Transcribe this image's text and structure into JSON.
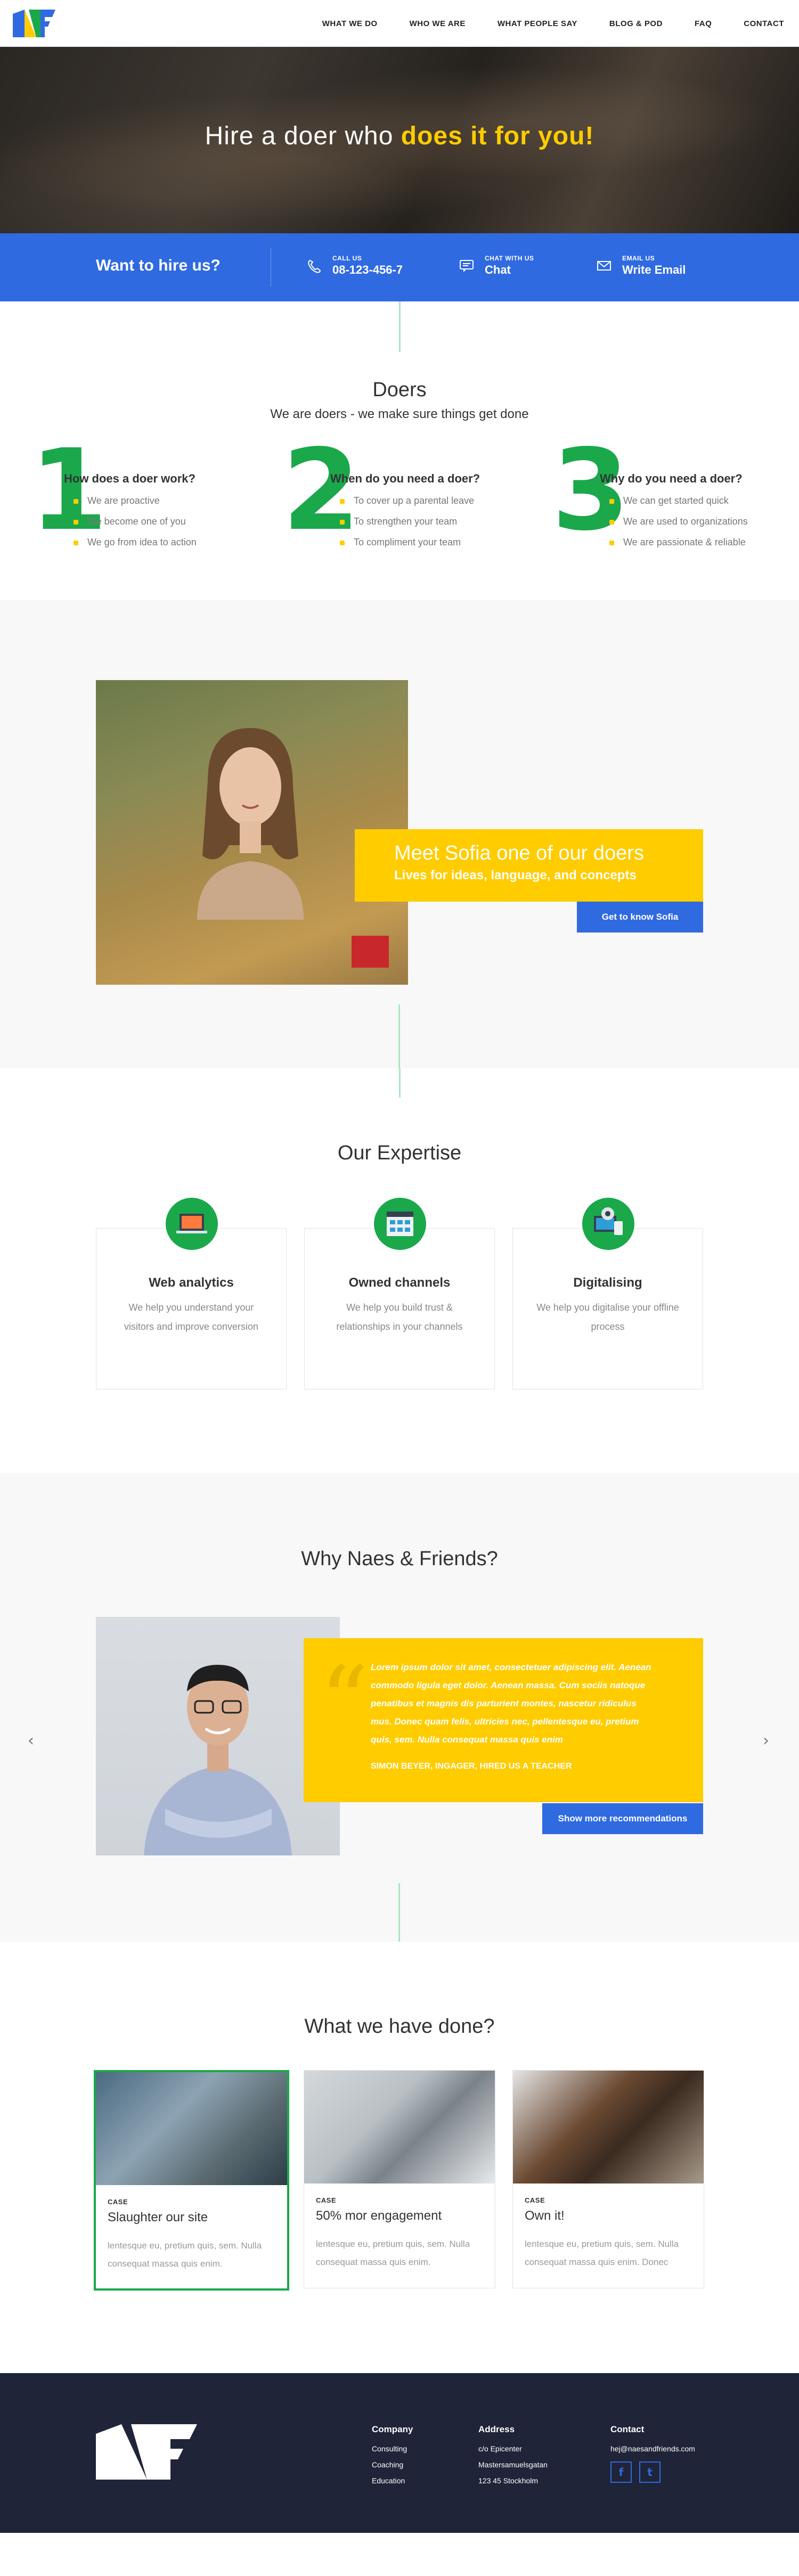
{
  "nav": {
    "items": [
      "WHAT WE DO",
      "WHO WE ARE",
      "WHAT PEOPLE SAY",
      "BLOG & POD",
      "FAQ",
      "CONTACT"
    ]
  },
  "hero": {
    "title_plain": "Hire a doer who ",
    "title_highlight": "does it for you!"
  },
  "contact_bar": {
    "title": "Want to hire us?",
    "call_label": "CALL US",
    "call_value": "08-123-456-7",
    "chat_label": "CHAT WITH US",
    "chat_value": "Chat",
    "email_label": "EMAIL US",
    "email_value": "Write Email"
  },
  "doers": {
    "title": "Doers",
    "subtitle": "We are doers - we make sure things get done",
    "columns": [
      {
        "num": "1",
        "question": "How does a doer work?",
        "items": [
          "We are proactive",
          "We become one of you",
          "We go from idea to action"
        ]
      },
      {
        "num": "2",
        "question": "When do you need a doer?",
        "items": [
          "To cover up a parental leave",
          "To strengthen your team",
          "To compliment your team"
        ]
      },
      {
        "num": "3",
        "question": "Why do you need a doer?",
        "items": [
          "We can get started quick",
          "We are used to organizations",
          "We are passionate & reliable"
        ]
      }
    ]
  },
  "sofia": {
    "heading": "Meet Sofia one of our doers",
    "sub": "Lives for ideas, language, and concepts",
    "button": "Get to know Sofia"
  },
  "expertise": {
    "title": "Our Expertise",
    "cards": [
      {
        "title": "Web analytics",
        "text": "We help you understand your visitors and improve conversion"
      },
      {
        "title": "Owned channels",
        "text": "We help you build  trust & relationships in your channels"
      },
      {
        "title": "Digitalising",
        "text": "We help you digitalise your offline process"
      }
    ]
  },
  "why": {
    "title": "Why Naes & Friends?",
    "quote": "Lorem ipsum dolor sit amet, consectetuer adipiscing elit. Aenean commodo ligula eget dolor. Aenean massa. Cum sociis natoque penatibus et magnis dis parturient montes, nascetur ridiculus mus. Donec quam felis, ultricies nec, pellentesque eu, pretium quis, sem. Nulla consequat massa quis enim",
    "author": "SIMON BEYER, INGAGER, HIRED US A TEACHER",
    "button": "Show more recommendations",
    "prev": "‹",
    "next": "›"
  },
  "cases": {
    "title": "What we have done?",
    "items": [
      {
        "tag": "CASE",
        "title": "Slaughter our site",
        "text": "lentesque eu, pretium quis, sem. Nulla consequat massa quis enim."
      },
      {
        "tag": "CASE",
        "title": "50% mor engagement",
        "text": "lentesque eu, pretium quis, sem. Nulla consequat massa quis enim."
      },
      {
        "tag": "CASE",
        "title": "Own it!",
        "text": "lentesque eu, pretium quis, sem. Nulla consequat massa quis enim. Donec"
      }
    ]
  },
  "footer": {
    "company_title": "Company",
    "company_items": [
      "Consulting",
      "Coaching",
      "Education"
    ],
    "address_title": "Address",
    "address_items": [
      "c/o Epicenter",
      "Mastersamuelsgatan",
      "123 45 Stockholm"
    ],
    "contact_title": "Contact",
    "contact_email": "hej@naesandfriends.com",
    "social_f": "f",
    "social_t": "t"
  },
  "colors": {
    "brand_blue": "#2f6ae0",
    "brand_yellow": "#ffcc00",
    "brand_green": "#1aa84b",
    "footer_bg": "#1f2438"
  }
}
